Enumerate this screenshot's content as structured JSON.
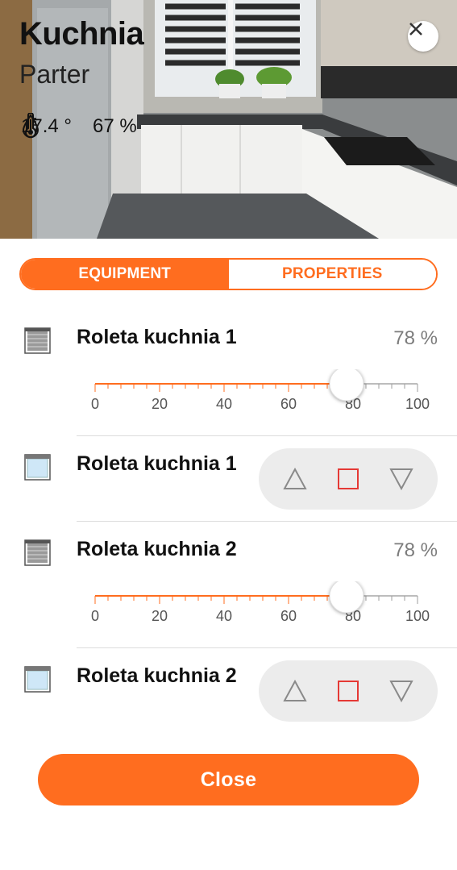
{
  "room": {
    "name": "Kuchnia",
    "floor": "Parter",
    "temperature": "17.4 °",
    "humidity": "67 %"
  },
  "tabs": [
    {
      "label": "EQUIPMENT",
      "active": true
    },
    {
      "label": "PROPERTIES",
      "active": false
    }
  ],
  "devices": [
    {
      "name": "Roleta kuchnia 1",
      "type": "slider",
      "value_label": "78 %",
      "level": 78,
      "scale": [
        "0",
        "20",
        "40",
        "60",
        "80",
        "100"
      ],
      "icon": "roller-blind-closed-icon"
    },
    {
      "name": "Roleta kuchnia 1",
      "type": "controls",
      "icon": "roller-blind-open-icon",
      "controls": [
        "up-triangle-icon",
        "stop-square-icon",
        "down-triangle-icon"
      ]
    },
    {
      "name": "Roleta kuchnia 2",
      "type": "slider",
      "value_label": "78 %",
      "level": 78,
      "scale": [
        "0",
        "20",
        "40",
        "60",
        "80",
        "100"
      ],
      "icon": "roller-blind-closed-icon"
    },
    {
      "name": "Roleta kuchnia 2",
      "type": "controls",
      "icon": "roller-blind-open-icon",
      "controls": [
        "up-triangle-icon",
        "stop-square-icon",
        "down-triangle-icon"
      ]
    }
  ],
  "close_label": "Close",
  "colors": {
    "accent": "#ff6d1f",
    "stop": "#e53935",
    "control_bg": "#ececec",
    "value_text": "#7c7c7c"
  }
}
